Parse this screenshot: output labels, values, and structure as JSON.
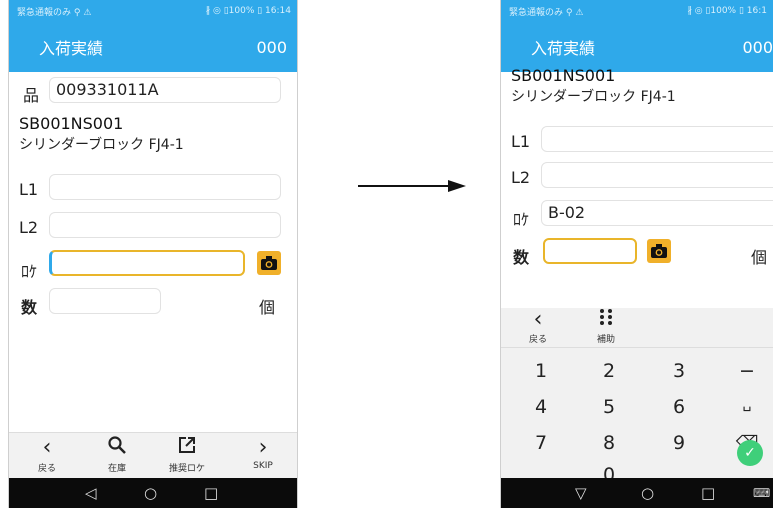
{
  "left": {
    "status": {
      "left": "緊急通報のみ ⚲ ⚠",
      "right": "∦ ◎ ▯100% ▯ 16:14"
    },
    "header": {
      "title": "入荷実績",
      "count": "000"
    },
    "item": {
      "label": "品",
      "value": "009331011A"
    },
    "product": {
      "code": "SB001NS001",
      "name": "シリンダーブロック FJ4-1"
    },
    "fields": {
      "l1": "L1",
      "l2": "L2",
      "loc": "ﾛｹ",
      "qty": "数",
      "unit": "個"
    },
    "toolbar": {
      "back": "戻る",
      "stock": "在庫",
      "suggest": "推奨ロケ",
      "skip": "SKIP"
    }
  },
  "right": {
    "status": {
      "left": "緊急通報のみ ⚲ ⚠",
      "right": "∦ ◎ ▯100% ▯ 16:1"
    },
    "header": {
      "title": "入荷実績",
      "count": "000"
    },
    "product": {
      "code": "SB001NS001",
      "name": "シリンダーブロック FJ4-1"
    },
    "fields": {
      "l1": "L1",
      "l2": "L2",
      "loc": "ﾛｹ",
      "loc_value": "B-02",
      "qty": "数",
      "unit": "個"
    },
    "kbd": {
      "back": "戻る",
      "assist": "補助"
    },
    "keys": [
      "1",
      "2",
      "3",
      "−",
      "4",
      "5",
      "6",
      "␣",
      "7",
      "8",
      "9",
      "⌫",
      ",",
      "0",
      ".",
      "✓"
    ]
  }
}
